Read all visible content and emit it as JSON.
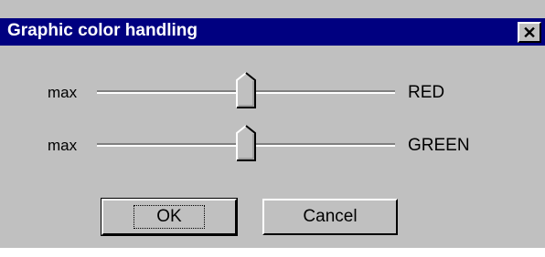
{
  "window": {
    "title": "Graphic color handling",
    "close_glyph": "✕"
  },
  "sliders": [
    {
      "left_label": "max",
      "right_label": "RED",
      "level_percent": 50
    },
    {
      "left_label": "max",
      "right_label": "GREEN",
      "level_percent": 50
    }
  ],
  "buttons": {
    "ok_label": "OK",
    "cancel_label": "Cancel"
  },
  "colors": {
    "titlebar": "#000080",
    "face": "#c0c0c0"
  },
  "icons": {
    "close": "close-icon"
  }
}
